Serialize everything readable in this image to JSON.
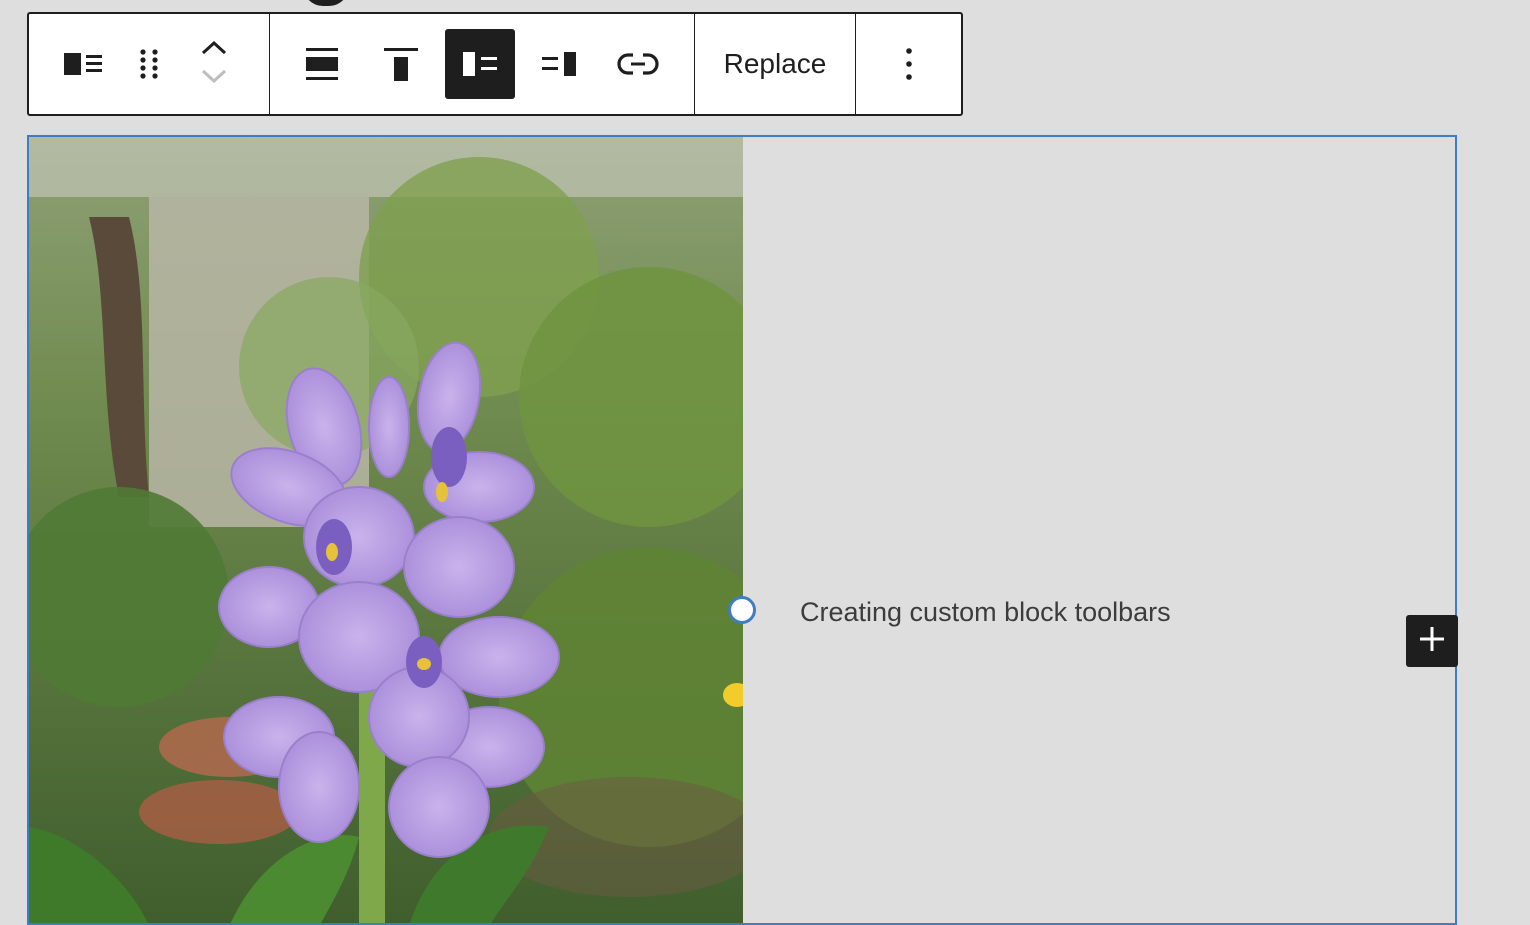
{
  "toolbar": {
    "block_icon": "media-text-icon",
    "drag_icon": "drag-handle-icon",
    "move_up_icon": "chevron-up-icon",
    "move_down_icon": "chevron-down-icon",
    "align_buttons": [
      {
        "icon": "align-wide-icon",
        "active": false
      },
      {
        "icon": "vertical-align-top-icon",
        "active": false
      },
      {
        "icon": "media-left-icon",
        "active": true
      },
      {
        "icon": "media-right-icon",
        "active": false
      },
      {
        "icon": "link-icon",
        "active": false
      }
    ],
    "replace_label": "Replace",
    "more_icon": "more-vertical-icon"
  },
  "block": {
    "media_image": "purple-hyacinth-flower-photo",
    "caption": "Creating custom block toolbars",
    "inserter_icon": "plus-icon"
  },
  "colors": {
    "accent": "#3d7dc4",
    "toolbar_dark": "#1e1e1e",
    "background": "#dedede"
  }
}
